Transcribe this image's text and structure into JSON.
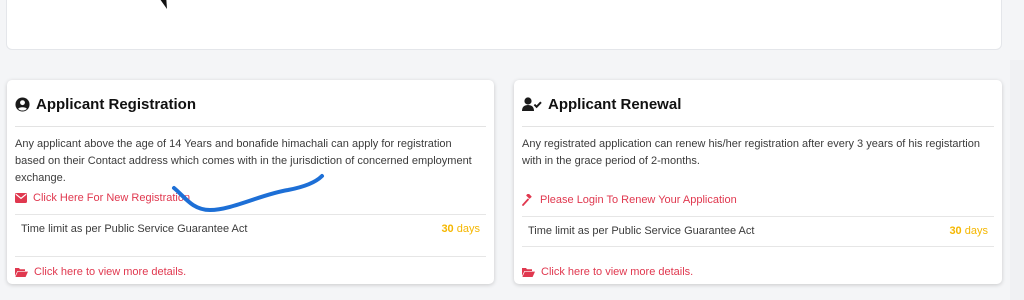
{
  "colors": {
    "link": "#e0384f",
    "days": "#f5b700",
    "scribble": "#1d6fd6"
  },
  "registration": {
    "title": "Applicant Registration",
    "icon": "user-circle-icon",
    "description": "Any applicant above the age of 14 Years and bonafide himachali can apply for registration based on their Contact address which comes with in the jurisdiction of concerned employment exchange.",
    "action_icon": "envelope-icon",
    "action_label": "Click Here For New Registration",
    "time_limit_label": "Time limit as per Public Service Guarantee Act",
    "time_limit_value": "30",
    "time_limit_unit": "days",
    "more_icon": "folder-open-icon",
    "more_label": "Click here to view more details."
  },
  "renewal": {
    "title": "Applicant Renewal",
    "icon": "user-check-icon",
    "description": "Any registrated application can renew his/her registration after every 3 years of his registartion with in the grace period of 2-months.",
    "action_icon": "gavel-icon",
    "action_label": "Please Login To Renew Your Application",
    "time_limit_label": "Time limit as per Public Service Guarantee Act",
    "time_limit_value": "30",
    "time_limit_unit": "days",
    "more_icon": "folder-open-icon",
    "more_label": "Click here to view more details."
  }
}
